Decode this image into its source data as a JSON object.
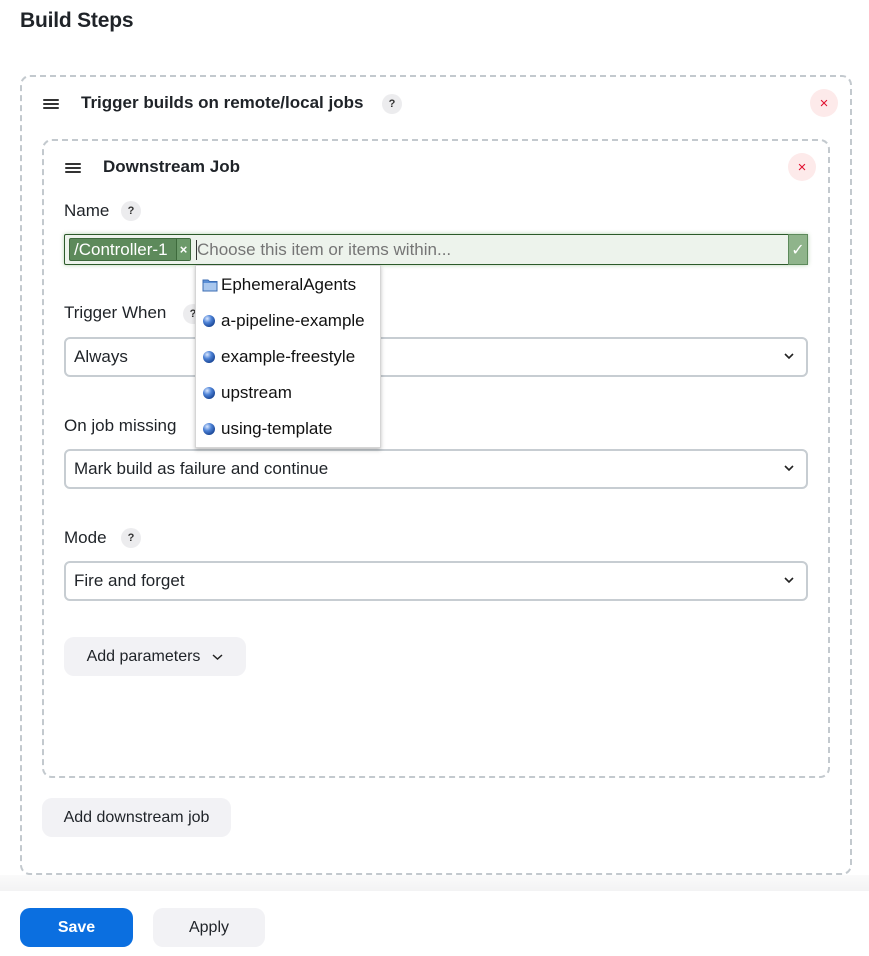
{
  "page": {
    "title": "Build Steps"
  },
  "build_step": {
    "title": "Trigger builds on remote/local jobs",
    "help": "?",
    "close_icon": "×",
    "downstream_job": {
      "title": "Downstream Job",
      "close_icon": "×",
      "name_field": {
        "label": "Name",
        "help": "?",
        "selected_chip": "/Controller-1",
        "chip_remove_icon": "×",
        "placeholder": "Choose this item or items within...",
        "valid_icon": "✓",
        "suggestions": [
          {
            "label": "EphemeralAgents",
            "icon": "folder-icon"
          },
          {
            "label": "a-pipeline-example",
            "icon": "job-status-ball-icon"
          },
          {
            "label": "example-freestyle",
            "icon": "job-status-ball-icon"
          },
          {
            "label": "upstream",
            "icon": "job-status-ball-icon"
          },
          {
            "label": "using-template",
            "icon": "job-status-ball-icon"
          }
        ]
      },
      "trigger_when": {
        "label": "Trigger When",
        "help": "?",
        "value": "Always"
      },
      "on_job_missing": {
        "label": "On job missing",
        "value": "Mark build as failure and continue"
      },
      "mode": {
        "label": "Mode",
        "help": "?",
        "value": "Fire and forget"
      },
      "add_parameters_label": "Add parameters"
    },
    "add_downstream_job_label": "Add downstream job"
  },
  "footer": {
    "save_label": "Save",
    "apply_label": "Apply"
  },
  "colors": {
    "primary": "#0b6fe0",
    "danger": "#e0102f",
    "valid_green": "#5d8a5b",
    "border": "#c7cdd2"
  }
}
